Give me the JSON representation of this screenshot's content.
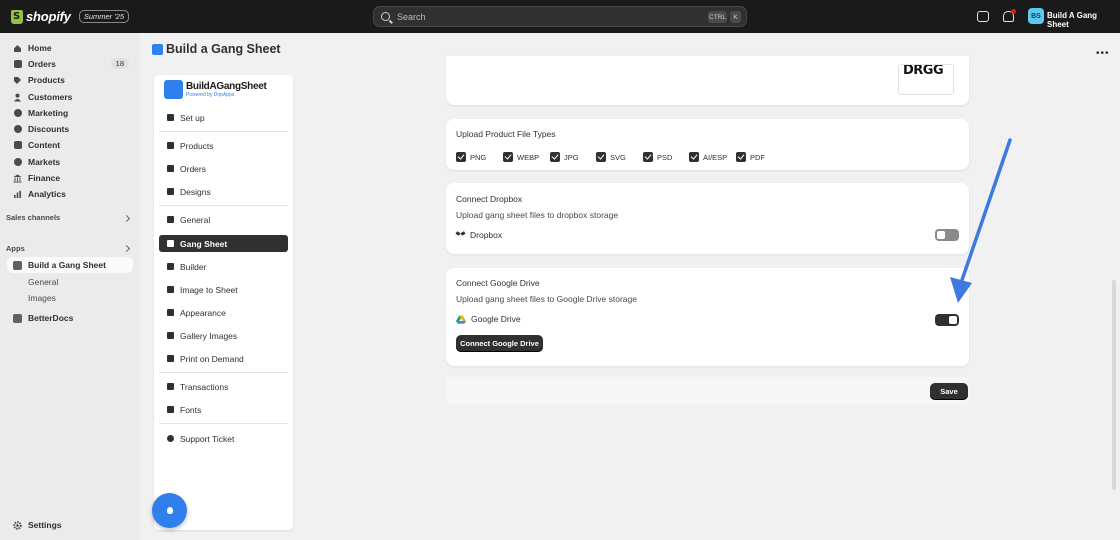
{
  "topbar": {
    "brand": "shopify",
    "edition": "Summer '25",
    "search_placeholder": "Search",
    "shortcut_ctrl": "CTRL",
    "shortcut_key": "K",
    "notification_count": "4",
    "avatar_initials": "BS",
    "store_name": "Build A Gang Sheet"
  },
  "sidebar": {
    "items": [
      {
        "label": "Home"
      },
      {
        "label": "Orders",
        "count": "18"
      },
      {
        "label": "Products"
      },
      {
        "label": "Customers"
      },
      {
        "label": "Marketing"
      },
      {
        "label": "Discounts"
      },
      {
        "label": "Content"
      },
      {
        "label": "Markets"
      },
      {
        "label": "Finance"
      },
      {
        "label": "Analytics"
      }
    ],
    "sales_channels_label": "Sales channels",
    "apps_label": "Apps",
    "app_active": "Build a Gang Sheet",
    "app_subitems": [
      "General",
      "Images"
    ],
    "other_app": "BetterDocs",
    "settings_label": "Settings"
  },
  "page": {
    "title": "Build a Gang Sheet"
  },
  "app_nav": {
    "logo_main": "BuildAGangSheet",
    "logo_sub": "Powered by DripApps",
    "items": [
      {
        "label": "Set up"
      },
      {
        "label": "Products"
      },
      {
        "label": "Orders"
      },
      {
        "label": "Designs"
      },
      {
        "label": "General"
      },
      {
        "label": "Gang Sheet"
      },
      {
        "label": "Builder"
      },
      {
        "label": "Image to Sheet"
      },
      {
        "label": "Appearance"
      },
      {
        "label": "Gallery Images"
      },
      {
        "label": "Print on Demand"
      },
      {
        "label": "Transactions"
      },
      {
        "label": "Fonts"
      },
      {
        "label": "Support Ticket"
      }
    ]
  },
  "file_types": {
    "title": "Upload Product File Types",
    "options": [
      {
        "label": "PNG",
        "checked": true
      },
      {
        "label": "WEBP",
        "checked": true
      },
      {
        "label": "JPG",
        "checked": true
      },
      {
        "label": "SVG",
        "checked": true
      },
      {
        "label": "PSD",
        "checked": true
      },
      {
        "label": "AI/ESP",
        "checked": true
      },
      {
        "label": "PDF",
        "checked": true
      }
    ]
  },
  "dropbox": {
    "title": "Connect Dropbox",
    "description": "Upload gang sheet files to dropbox storage",
    "service_label": "Dropbox",
    "enabled": false
  },
  "google_drive": {
    "title": "Connect Google Drive",
    "description": "Upload gang sheet files to Google Drive storage",
    "service_label": "Google Drive",
    "enabled": true,
    "connect_button": "Connect Google Drive"
  },
  "actions": {
    "save_label": "Save"
  },
  "colors": {
    "arrow": "#3d7be0",
    "accent": "#2f80ed"
  }
}
